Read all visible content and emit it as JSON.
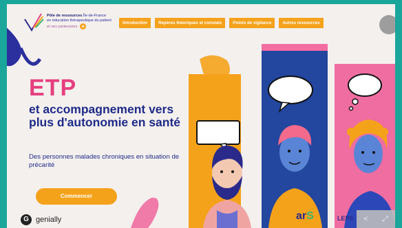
{
  "header": {
    "org_title": "Pôle de ressources",
    "org_line1": "Île-de-France",
    "org_line2": "en éducation thérapeutique du patient",
    "org_line3": "et ses partenaires",
    "plus_label": "+"
  },
  "nav": {
    "tabs": [
      "Introduction",
      "Repères théoriques et constats",
      "Points de vigilance",
      "Autres ressources"
    ]
  },
  "hero": {
    "title": "ETP",
    "subtitle": "et accompagnement vers plus d'autonomie en santé",
    "description": "Des personnes malades chroniques en situation de précarité",
    "cta_label": "Commencer"
  },
  "footer": {
    "brand": "genially",
    "brand_glyph": "G",
    "partner1_main": "ar",
    "partner1_accent": "S",
    "partner2": "LEPS",
    "share_glyph": "<",
    "fullscreen_glyph": "⤢"
  },
  "colors": {
    "teal_border": "#1aa69a",
    "accent_orange": "#f5a21b",
    "accent_pink": "#e5407e",
    "navy": "#1e2a88",
    "blue_panel": "#23469e"
  }
}
